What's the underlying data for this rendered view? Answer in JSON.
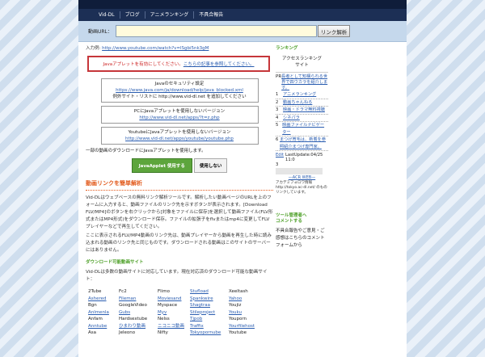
{
  "nav": {
    "items": [
      "Vid-DL",
      "ブログ",
      "アニメランキング",
      "不具合報告"
    ]
  },
  "search": {
    "label": "動画URL：",
    "value": "",
    "button": "リンク解析"
  },
  "example": {
    "prefix": "入力例:",
    "url": "http://www.youtube.com/watch?v=lSgbi5nk3gM"
  },
  "warning": {
    "text": "Javaアプレットを有効にしてください。",
    "link": "こちらの記事を参照してください。"
  },
  "java_boxes": [
    {
      "title": "Javaのセキュリティ設定",
      "link": "https://www.java.com/ja/download/help/java_blocked.xml",
      "extra": "例外サイト・リストに http://www.vid-dl.net を追加してください"
    },
    {
      "title": "PCにJavaアプレットを使用しないバージョン",
      "link": "http://www.vid-dl.net/apps/?t=z.php"
    },
    {
      "title": "YoutubeにJavaアプレットを使用しないバージョン",
      "link": "http://www.vid-dl.net/apps/youtube/youtube.php"
    }
  ],
  "note": {
    "text": "一部の動画のダウンロードにJavaアプレットを使用します。"
  },
  "applet": {
    "use": "JavaApplet 使用する",
    "nouse": "使用しない"
  },
  "section": {
    "title": "動画リンクを簡単解析",
    "p1": "Vid-DLはウェブベースの無料リンク解析ツールです。解析したい動画ページのURLを上のフォームに入力すると、動画ファイルのリンク先を示すボタンが表示されます。[Download FLV/MP4]のボタンを右クリックから[対象をファイルに保存]を選択して動画ファイル(FLV形式またはMP4形式)をダウンロード保存。ファイルの拡張子をflvまたはmp4に変更してFLVプレイヤーなどで再生してください。",
    "p2": "ここに表示されるFLV/MP4動画のリンク先は、動画プレイヤーから動画を再生した時に読み込まれる動画のリンク先と同じものです。ダウンロードされる動画はこのサイトのサーバーにはありません。",
    "subtitle": "ダウンロード可能動画サイト",
    "p3": "Vid-DLは多数の動画サイトに対応しています。現在対応済のダウンロード可能な動画サイト："
  },
  "sites": [
    [
      "2Tube",
      "Fc2",
      "Flimo",
      "Stufload",
      "Xeeltash"
    ],
    [
      "Ashered",
      "Fileman",
      "Moviesand",
      "Spankwire",
      "Yahoo"
    ],
    [
      "Bgn",
      "GoogleVideo",
      "Myspace",
      "Shagtraa",
      "Youjiz"
    ],
    [
      "Anlmenla",
      "Gubs",
      "Myv",
      "Stileproject",
      "Youku"
    ],
    [
      "Anfam",
      "Hardsextube",
      "Nelss",
      "Tjpob",
      "Youporn"
    ],
    [
      "Anntube",
      "ひまわり動画",
      "ニコニコ動画",
      "Traffix",
      "Yourfilehost"
    ],
    [
      "Asa",
      "Jeleono",
      "Nifty",
      "Tokyopornube",
      "Youtube"
    ]
  ],
  "sidebar": {
    "ranking_title": "ランキング",
    "ranking_head": "アクセスランキング\nサイト",
    "pr_label": "PR",
    "pr1": "長者として知構られる世界で四ウカラを紹介します。",
    "items": [
      "アニメランキング",
      "動画ちゃんねる",
      "映画・ドラマ無料視聴",
      "シネパラ",
      "映画ファイルナビゲーター",
      "まつげ育毛は、新着を参照紹介まつげ専門家。"
    ],
    "lastupdate": "LastUpdate:04/25 11:0",
    "edit": "Edit",
    "three": "3",
    "acr": "—ACR WEB—",
    "small1": "アカデミフォロワ情報",
    "small2": "http://tokyo.ac-dl.net/ のもの",
    "small3": "リンクしています。",
    "tool_title": "ツール管理者へ\nコメントする",
    "tool_text": "不具合報告やご意見・ご感想はこちらのコメントフォームから"
  }
}
